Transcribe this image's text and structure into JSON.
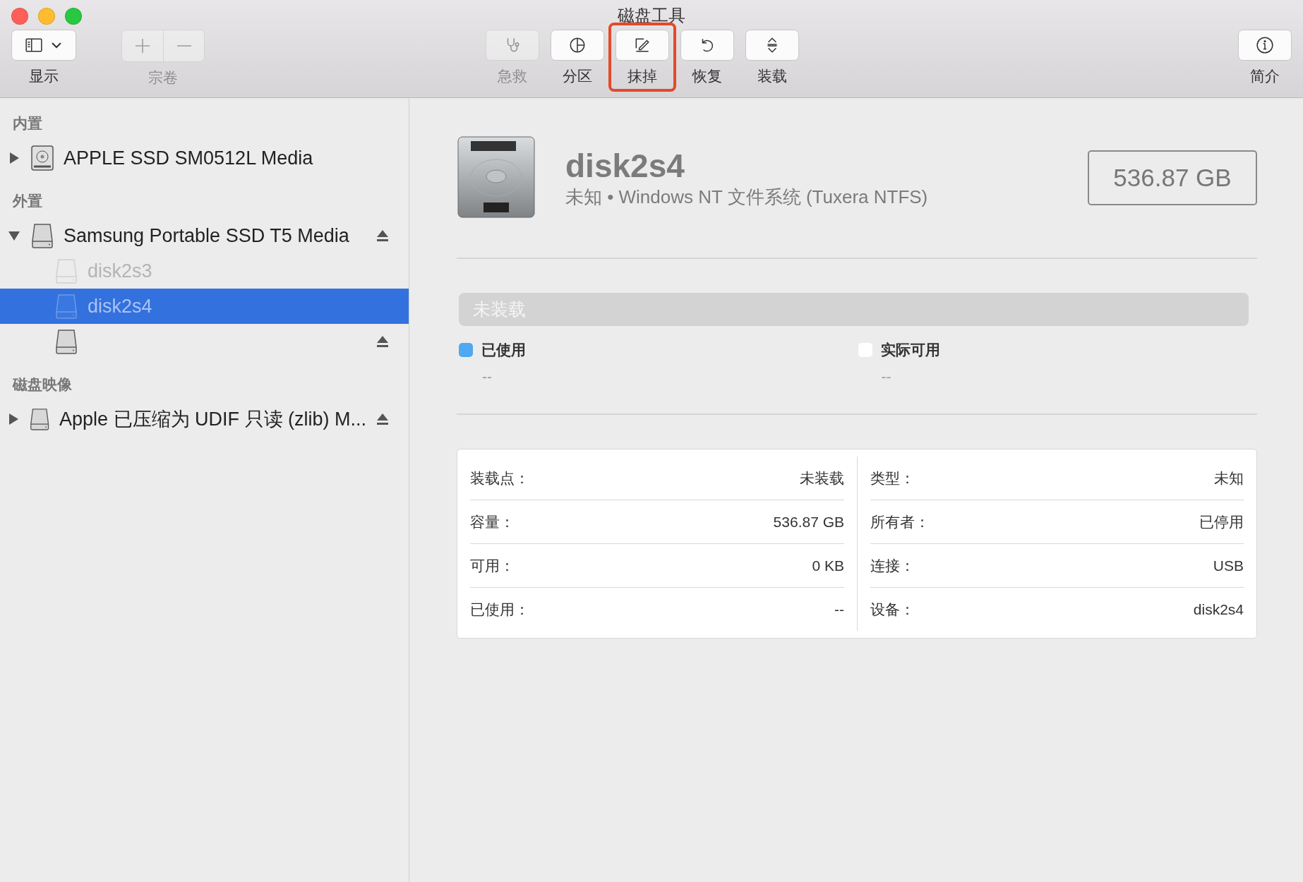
{
  "window": {
    "title": "磁盘工具"
  },
  "toolbar": {
    "left": [
      {
        "kind": "view",
        "label": "显示",
        "disabled": false
      },
      {
        "kind": "volume",
        "label": "宗卷",
        "disabled": true
      }
    ],
    "center": [
      {
        "kind": "firstaid",
        "label": "急救",
        "disabled": true,
        "highlighted": false
      },
      {
        "kind": "partition",
        "label": "分区",
        "disabled": false,
        "highlighted": false
      },
      {
        "kind": "erase",
        "label": "抹掉",
        "disabled": false,
        "highlighted": true
      },
      {
        "kind": "restore",
        "label": "恢复",
        "disabled": false,
        "highlighted": false
      },
      {
        "kind": "mount",
        "label": "装载",
        "disabled": false,
        "highlighted": false
      }
    ],
    "right": [
      {
        "kind": "info",
        "label": "简介",
        "disabled": false
      }
    ]
  },
  "sidebar": {
    "sections": [
      {
        "title": "内置",
        "items": [
          {
            "kind": "internal",
            "label": "APPLE SSD SM0512L Media",
            "expanded": false,
            "ejectable": false,
            "selected": false,
            "disabled": false
          }
        ]
      },
      {
        "title": "外置",
        "items": [
          {
            "kind": "external",
            "label": "Samsung Portable SSD T5 Media",
            "expanded": true,
            "ejectable": true,
            "selected": false,
            "disabled": false,
            "children": [
              {
                "kind": "volume",
                "label": "disk2s3",
                "ejectable": false,
                "selected": false,
                "disabled": true
              },
              {
                "kind": "volume",
                "label": "disk2s4",
                "ejectable": false,
                "selected": true,
                "disabled": true
              },
              {
                "kind": "volume",
                "ejectable": true,
                "selected": false,
                "disabled": false
              }
            ]
          }
        ]
      },
      {
        "title": "磁盘映像",
        "items": [
          {
            "kind": "external",
            "label": "Apple 已压缩为 UDIF 只读 (zlib) M...",
            "expanded": false,
            "ejectable": true,
            "selected": false,
            "disabled": false
          }
        ]
      }
    ]
  },
  "detail": {
    "name": "disk2s4",
    "subtitle": "未知 • Windows NT 文件系统 (Tuxera NTFS)",
    "capacity": "536.87 GB",
    "usage_bar": {
      "label": "未装载"
    },
    "legend": [
      {
        "label": "已使用",
        "value": "--",
        "color": "#4fa8f0"
      },
      {
        "label": "实际可用",
        "value": "--",
        "color": "#ffffff"
      }
    ],
    "info": [
      [
        {
          "key": "装载点：",
          "value": "未装载"
        },
        {
          "key": "容量：",
          "value": "536.87 GB"
        },
        {
          "key": "可用：",
          "value": "0 KB"
        },
        {
          "key": "已使用：",
          "value": "--"
        }
      ],
      [
        {
          "key": "类型：",
          "value": "未知"
        },
        {
          "key": "所有者：",
          "value": "已停用"
        },
        {
          "key": "连接：",
          "value": "USB"
        },
        {
          "key": "设备：",
          "value": "disk2s4"
        }
      ]
    ]
  }
}
